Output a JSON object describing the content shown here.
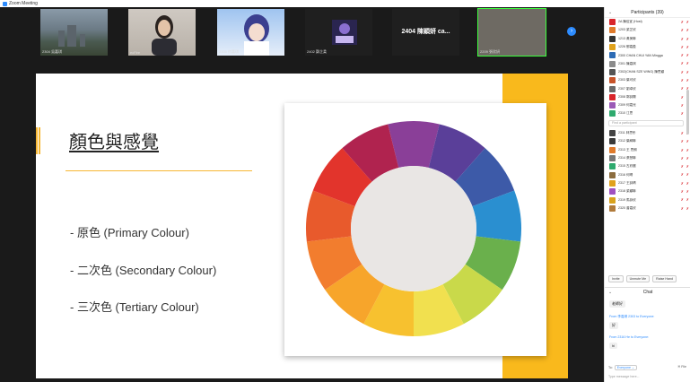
{
  "window": {
    "title": "Zoom Meeting"
  },
  "gallery": {
    "tiles": [
      {
        "name": "2304 吳嘉琪"
      },
      {
        "name": "ecFire"
      },
      {
        "name": "2305 何嘉琪"
      },
      {
        "name": "2402 鄭芷柔"
      },
      {
        "name": "2404 陳穎妍 ca...",
        "big_name": "2404 陳穎妍 ca..."
      },
      {
        "name": "2209 張欣妍"
      }
    ],
    "next_glyph": "›"
  },
  "slide": {
    "heading": "顏色與感覺",
    "bullets": [
      "- 原色 (Primary Colour)",
      "- 二次色 (Secondary Colour)",
      "- 三次色 (Tertiary Colour)"
    ],
    "wheel_colors": [
      "#8a3f98",
      "#5a3f99",
      "#3d5aa8",
      "#2a8fd0",
      "#6ab04c",
      "#c9d94a",
      "#f1e04f",
      "#f7c12f",
      "#f7a52b",
      "#f27d2e",
      "#e85a2c",
      "#e2342c",
      "#b0234f"
    ],
    "accent": "#f9b91c"
  },
  "participants": {
    "title": "Participants (39)",
    "collapse_glyph": "⌄",
    "search_placeholder": "Find a participant",
    "mic_glyph": "✗",
    "cam_glyph": "✗",
    "top_rows": [
      {
        "name": "2A 陳佳宜 (Host)",
        "color": "#d9252b"
      },
      {
        "name": "1203 梁芷欣",
        "color": "#e07b2c"
      },
      {
        "name": "1213 黃美琳",
        "color": "#333333"
      },
      {
        "name": "1226 鄧嘉盈",
        "color": "#e0a21c"
      },
      {
        "name": "2300 CHAN CHUI YAN Mingga",
        "color": "#2d6cb5"
      },
      {
        "name": "2301 陳嘉琪",
        "color": "#8c8c8c"
      },
      {
        "name": "2302(CHAN SZE WING) 陳思穎",
        "color": "#555555"
      },
      {
        "name": "2303 葉可欣",
        "color": "#c8542a"
      },
      {
        "name": "2307 劉卓欣",
        "color": "#6b6b6b"
      },
      {
        "name": "2308 郭詩陽",
        "color": "#d9252b"
      },
      {
        "name": "2309 何嘉兒",
        "color": "#9b59b6"
      },
      {
        "name": "2310 江思",
        "color": "#2eaa6e"
      }
    ],
    "bottom_rows": [
      {
        "name": "2311 林思彤",
        "color": "#444444"
      },
      {
        "name": "2312 葉綺琳",
        "color": "#3a3a3a"
      },
      {
        "name": "2313 王 思朗",
        "color": "#e07b2c"
      },
      {
        "name": "2314 張慧琳",
        "color": "#777777"
      },
      {
        "name": "2315 古欣麗",
        "color": "#2eaa6e"
      },
      {
        "name": "2316 何晴",
        "color": "#8c6d3f"
      },
      {
        "name": "2317 王詩晴",
        "color": "#e0a21c"
      },
      {
        "name": "2318 梁穎琳",
        "color": "#a050c0"
      },
      {
        "name": "2319 馬詠欣",
        "color": "#d9a21c"
      },
      {
        "name": "2320 曾嘉欣",
        "color": "#b07a3a"
      }
    ],
    "actions": [
      "Invite",
      "Unmute Me",
      "Raise Hand"
    ]
  },
  "chat": {
    "title": "Chat",
    "messages": [
      {
        "from": "",
        "text": "老師好"
      },
      {
        "from": "From 李嘉琪 2303 to Everyone:",
        "text": "好"
      },
      {
        "from": "From 2316 He to Everyone:",
        "text": "hi"
      }
    ],
    "to_label": "To:",
    "to_value": "Everyone ⌄",
    "file_label": "🗎 File",
    "input_placeholder": "Type message here..."
  }
}
